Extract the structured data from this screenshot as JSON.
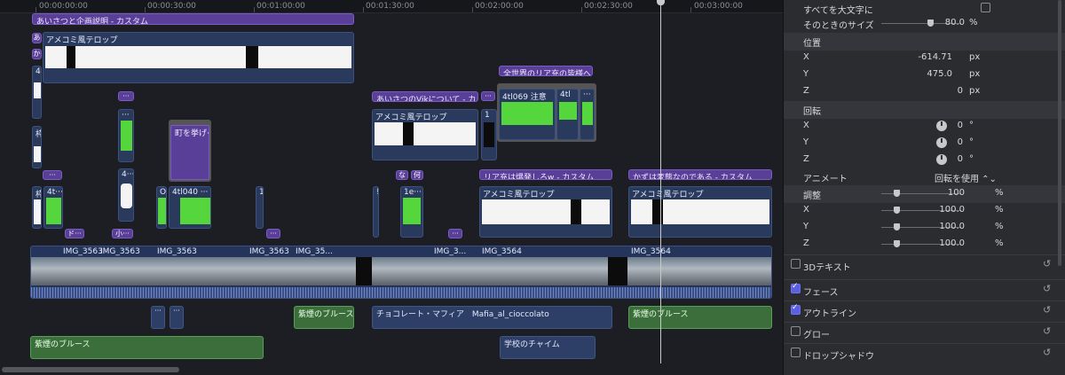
{
  "ruler": {
    "labels": [
      "00:00:00:00",
      "00:00:30:00",
      "00:01:00:00",
      "00:01:30:00",
      "00:02:00:00",
      "00:02:30:00",
      "00:03:00:00"
    ]
  },
  "titles": {
    "t1": "あいさつと企画説明 - カスタム",
    "t2": "あいさつのVikについて - カスタム",
    "t3": "全世界のリア充の皆様へ -...",
    "t4": "リア充は爆発しろw - カスタム",
    "t5": "かずは変態なのである - カスタム",
    "t6": "な",
    "t7": "何",
    "mini_a": "あ",
    "mini_ka": "か",
    "mini_4": "4",
    "mini_dots": "···",
    "mini_do": "ド···",
    "mini_ko": "小···"
  },
  "video": {
    "amecomi1": "アメコミ風テロップ",
    "amecomi2": "アメコミ風テロップ",
    "amecomi3": "アメコミ風テロップ",
    "amecomi4": "アメコミ風テロップ",
    "tl069": "4tl069 注意",
    "tl4": "4tl",
    "tl040": "4tl040 ···",
    "tl_4t": "4t···",
    "tl_o": "O",
    "tl_1e": "1e···",
    "machi": "町を挙げ···",
    "kan": "枠",
    "kan2": "枠",
    "four": "4···",
    "one": "1",
    "exc": "!"
  },
  "main": {
    "c1": "IMG_3563",
    "c2": "IMG_3563",
    "c3": "IMG_3563",
    "c4": "IMG_3563",
    "c5": "IMG_35...",
    "c6": "IMG_3...",
    "c7": "IMG_3564",
    "c8": "IMG_3564"
  },
  "audio": {
    "a1": "紫煙のブルース",
    "a2": "紫煙のブルース",
    "a3": "紫煙のブルース",
    "b1": "チョコレート・マフィア　Mafia_al_cioccolato",
    "b2": "学校のチャイム"
  },
  "inspector": {
    "all_caps": "すべてを大文字に",
    "size_label": "そのときのサイズ",
    "size_val": "80.0",
    "size_unit": "%",
    "position": "位置",
    "x": "X",
    "y": "Y",
    "z": "Z",
    "pos_x": "-614.71",
    "pos_y": "475.0",
    "pos_z": "0",
    "px": "px",
    "rotation": "回転",
    "rot_x": "0",
    "rot_y": "0",
    "rot_z": "0",
    "deg": "°",
    "animate": "アニメート",
    "animate_val": "回転を使用 ⌃⌄",
    "adjust": "調整",
    "adj_val": "100",
    "adj_x": "100.0",
    "adj_y": "100.0",
    "adj_z": "100.0",
    "pct": "%",
    "g_3d": "3Dテキスト",
    "g_face": "フェース",
    "g_outline": "アウトライン",
    "g_glow": "グロー",
    "g_shadow": "ドロップシャドウ",
    "reset": "↺"
  }
}
